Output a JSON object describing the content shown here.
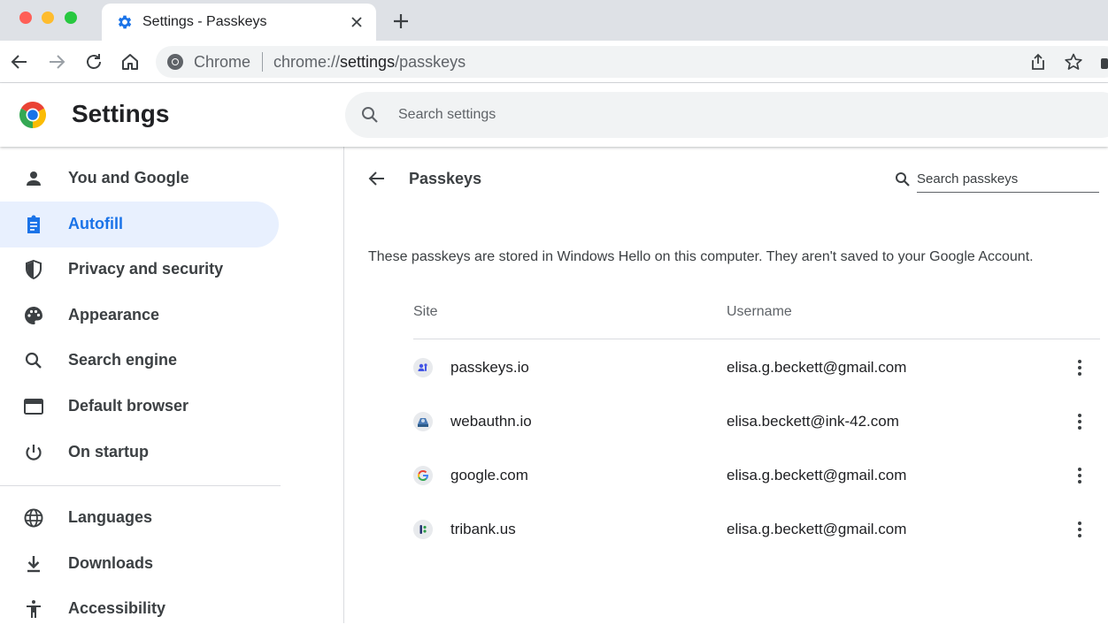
{
  "browser": {
    "tab_title": "Settings - Passkeys",
    "omnibox_chip": "Chrome",
    "url_prefix": "chrome://",
    "url_host": "settings",
    "url_path": "/passkeys"
  },
  "header": {
    "title": "Settings",
    "search_placeholder": "Search settings"
  },
  "sidebar": {
    "items": [
      {
        "label": "You and Google",
        "icon": "person-icon"
      },
      {
        "label": "Autofill",
        "icon": "clipboard-icon",
        "active": true
      },
      {
        "label": "Privacy and security",
        "icon": "shield-icon"
      },
      {
        "label": "Appearance",
        "icon": "palette-icon"
      },
      {
        "label": "Search engine",
        "icon": "search-icon"
      },
      {
        "label": "Default browser",
        "icon": "browser-window-icon"
      },
      {
        "label": "On startup",
        "icon": "power-icon"
      },
      {
        "label": "Languages",
        "icon": "globe-icon"
      },
      {
        "label": "Downloads",
        "icon": "download-icon"
      },
      {
        "label": "Accessibility",
        "icon": "accessibility-icon"
      }
    ]
  },
  "main": {
    "heading": "Passkeys",
    "search_placeholder": "Search passkeys",
    "info": "These passkeys are stored in Windows Hello on this computer. They aren't saved to your Google Account.",
    "columns": {
      "site": "Site",
      "username": "Username"
    },
    "rows": [
      {
        "site": "passkeys.io",
        "username": "elisa.g.beckett@gmail.com"
      },
      {
        "site": "webauthn.io",
        "username": "elisa.beckett@ink-42.com"
      },
      {
        "site": "google.com",
        "username": "elisa.g.beckett@gmail.com"
      },
      {
        "site": "tribank.us",
        "username": "elisa.g.beckett@gmail.com"
      }
    ]
  },
  "colors": {
    "accent": "#1a73e8",
    "active_nav_bg": "#e8f0fe",
    "tabstrip_bg": "#dee1e6"
  }
}
